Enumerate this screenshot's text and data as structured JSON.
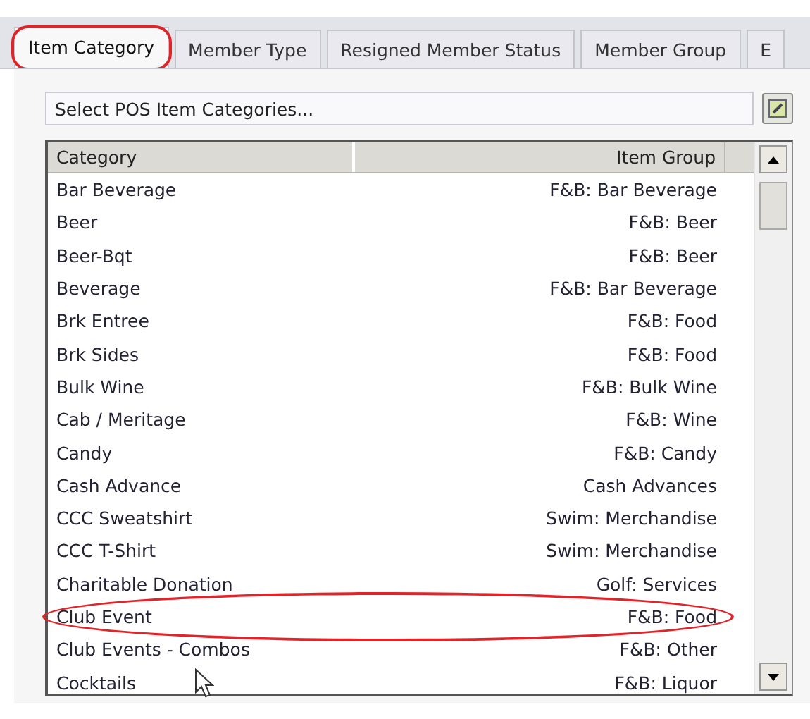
{
  "tabs": [
    {
      "label": "Item Category",
      "selected": true,
      "circled": true
    },
    {
      "label": "Member Type",
      "selected": false,
      "circled": false
    },
    {
      "label": "Resigned Member Status",
      "selected": false,
      "circled": false
    },
    {
      "label": "Member Group",
      "selected": false,
      "circled": false
    },
    {
      "label": "E",
      "selected": false,
      "circled": false
    }
  ],
  "select_field": {
    "value": "Select POS Item Categories..."
  },
  "table": {
    "columns": [
      "Category",
      "Item Group"
    ],
    "rows": [
      {
        "category": "Bar Beverage",
        "item_group": "F&B: Bar Beverage",
        "circled": false
      },
      {
        "category": "Beer",
        "item_group": "F&B: Beer",
        "circled": false
      },
      {
        "category": "Beer-Bqt",
        "item_group": "F&B: Beer",
        "circled": false
      },
      {
        "category": "Beverage",
        "item_group": "F&B: Bar Beverage",
        "circled": false
      },
      {
        "category": "Brk Entree",
        "item_group": "F&B: Food",
        "circled": false
      },
      {
        "category": "Brk Sides",
        "item_group": "F&B: Food",
        "circled": false
      },
      {
        "category": "Bulk Wine",
        "item_group": "F&B: Bulk Wine",
        "circled": false
      },
      {
        "category": "Cab / Meritage",
        "item_group": "F&B: Wine",
        "circled": false
      },
      {
        "category": "Candy",
        "item_group": "F&B: Candy",
        "circled": false
      },
      {
        "category": "Cash Advance",
        "item_group": "Cash Advances",
        "circled": false
      },
      {
        "category": "CCC Sweatshirt",
        "item_group": "Swim: Merchandise",
        "circled": false
      },
      {
        "category": "CCC T-Shirt",
        "item_group": "Swim: Merchandise",
        "circled": false
      },
      {
        "category": "Charitable Donation",
        "item_group": "Golf: Services",
        "circled": false
      },
      {
        "category": "Club Event",
        "item_group": "F&B: Food",
        "circled": true
      },
      {
        "category": "Club Events - Combos",
        "item_group": "F&B: Other",
        "circled": false
      },
      {
        "category": "Cocktails",
        "item_group": "F&B: Liquor",
        "circled": false
      }
    ]
  }
}
